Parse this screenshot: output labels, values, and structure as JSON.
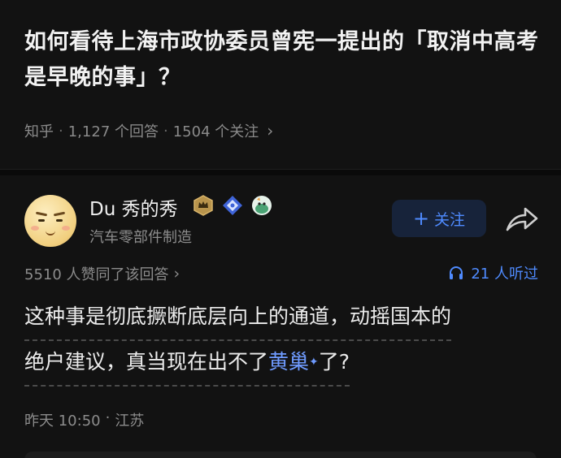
{
  "question": {
    "title": "如何看待上海市政协委员曾宪一提出的「取消中高考是早晚的事」？",
    "source": "知乎",
    "answer_count": "1,127 个回答",
    "follower_count": "1504 个关注"
  },
  "author": {
    "name": "Du 秀的秀",
    "subtitle": "汽车零部件制造",
    "follow_label": "关注",
    "badges": [
      "crown-badge-icon",
      "diamond-badge-icon",
      "mascot-badge-icon"
    ]
  },
  "answer": {
    "upvotes": "5510 人赞同了该回答",
    "listeners": "21 人听过",
    "text_line1": "这种事是彻底撅断底层向上的通道，动摇国本的",
    "text_line2_a": "绝户建议，真当现在出不了",
    "text_line2_link": "黄巢",
    "text_line2_b": "了?",
    "time": "昨天 10:50",
    "location": "江苏"
  },
  "colors": {
    "background": "#121212",
    "accent": "#4f8bff",
    "muted": "#8c8c8c"
  }
}
